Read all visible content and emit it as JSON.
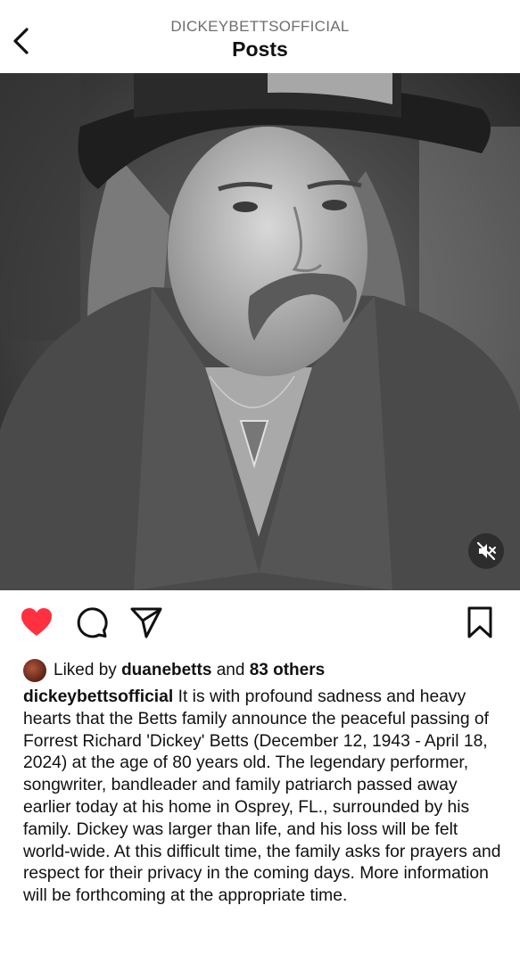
{
  "header": {
    "account": "DICKEYBETTSOFFICIAL",
    "title": "Posts"
  },
  "post": {
    "liked": true,
    "liked_by_prefix": "Liked by",
    "liked_by_user": "duanebetts",
    "liked_by_joiner": "and",
    "liked_by_others": "83 others",
    "caption_user": "dickeybettsofficial",
    "caption_text": "It is with profound sadness and heavy hearts that the Betts family announce the peaceful passing of Forrest Richard 'Dickey' Betts (December 12, 1943 - April 18, 2024) at the age of 80 years old. The legendary performer, songwriter, bandleader and family patriarch passed away earlier today at his home in Osprey, FL., surrounded by his family. Dickey was larger than life, and his loss will be felt world-wide. At this difficult time, the family asks for prayers and respect for their privacy in the coming days. More information will be forthcoming at the appropriate time."
  },
  "icons": {
    "back": "chevron-left-icon",
    "mute": "speaker-muted-icon",
    "like": "heart-icon",
    "comment": "comment-bubble-icon",
    "share": "paper-plane-icon",
    "save": "bookmark-icon"
  },
  "colors": {
    "like_active": "#ff3040",
    "secondary_text": "#6e6e6e"
  }
}
